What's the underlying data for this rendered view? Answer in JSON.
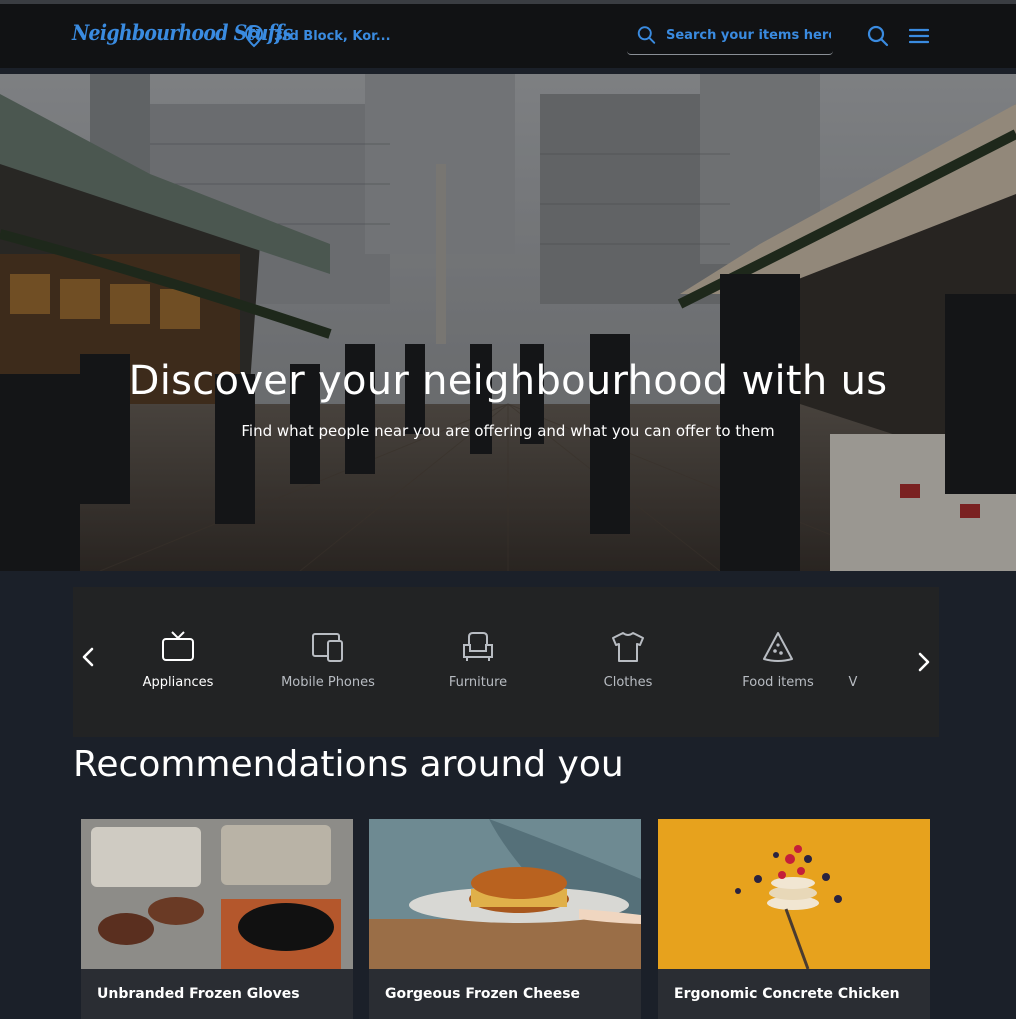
{
  "header": {
    "logo": "Neighbourhood Stuffs",
    "location": "3rd Block, Kor...",
    "search_placeholder": "Search your items here...",
    "accent": "#3a8be0"
  },
  "hero": {
    "title": "Discover your neighbourhood with us",
    "subtitle": "Find what people near you are offering and what you can offer to them"
  },
  "categories": {
    "items": [
      {
        "label": "Appliances",
        "icon": "tv-icon",
        "active": true
      },
      {
        "label": "Mobile Phones",
        "icon": "devices-icon"
      },
      {
        "label": "Furniture",
        "icon": "armchair-icon"
      },
      {
        "label": "Clothes",
        "icon": "tshirt-icon"
      },
      {
        "label": "Food items",
        "icon": "pizza-slice-icon"
      },
      {
        "label": "V"
      }
    ]
  },
  "recommendations": {
    "title": "Recommendations around you",
    "cards": [
      {
        "title": "Unbranded Frozen Gloves"
      },
      {
        "title": "Gorgeous Frozen Cheese"
      },
      {
        "title": "Ergonomic Concrete Chicken"
      }
    ]
  }
}
